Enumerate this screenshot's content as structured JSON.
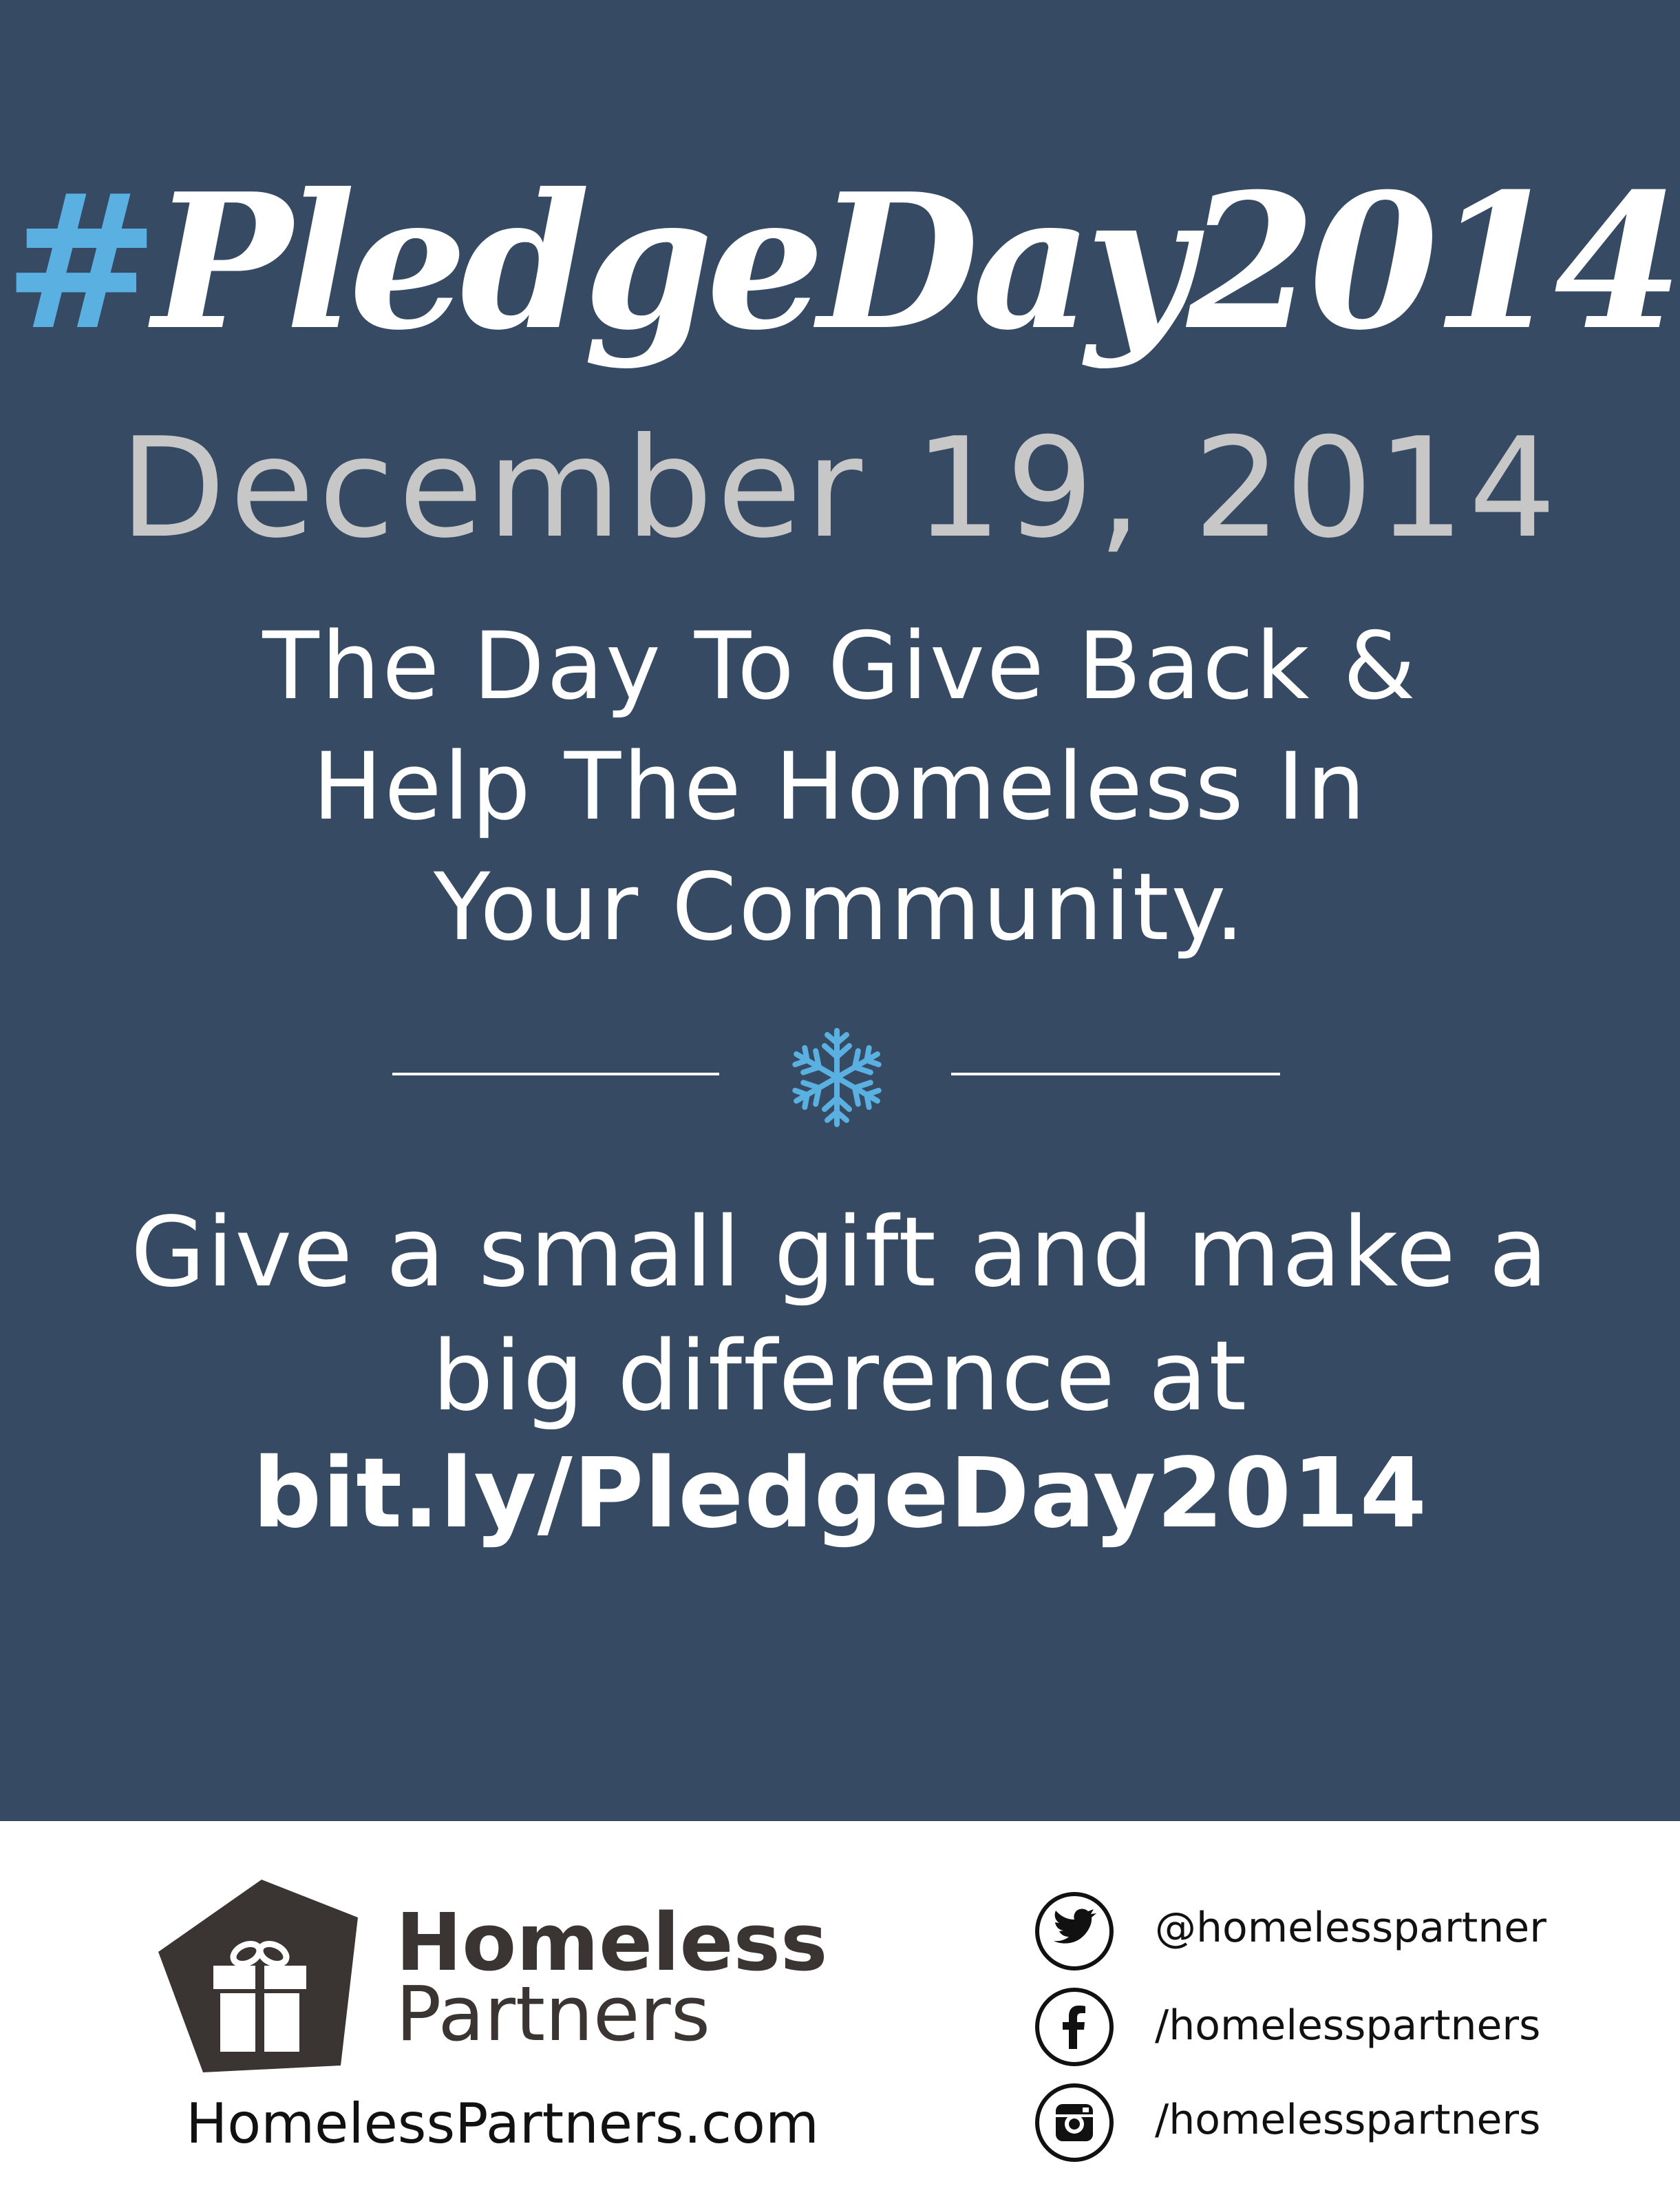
{
  "hero": {
    "hashtag_symbol": "#",
    "hashtag_text": "PledgeDay2014",
    "date": "December 19, 2014",
    "tagline_lines": [
      "The Day To Give Back &",
      "Help The Homeless In",
      "Your Community."
    ],
    "cta_lines": [
      "Give a small gift and make a",
      "big difference at"
    ],
    "link": "bit.ly/PledgeDay2014"
  },
  "footer": {
    "brand_line1": "Homeless",
    "brand_line2": "Partners",
    "website": "HomelessPartners.com",
    "social": [
      {
        "icon": "twitter-icon",
        "handle": "@homelesspartner"
      },
      {
        "icon": "facebook-icon",
        "handle": "/homelesspartners"
      },
      {
        "icon": "instagram-icon",
        "handle": "/homelesspartners"
      }
    ]
  },
  "colors": {
    "background": "#364a63",
    "accent": "#5ab0e0",
    "date_gray": "#c7c7c7",
    "logo_dark": "#3a3432"
  }
}
